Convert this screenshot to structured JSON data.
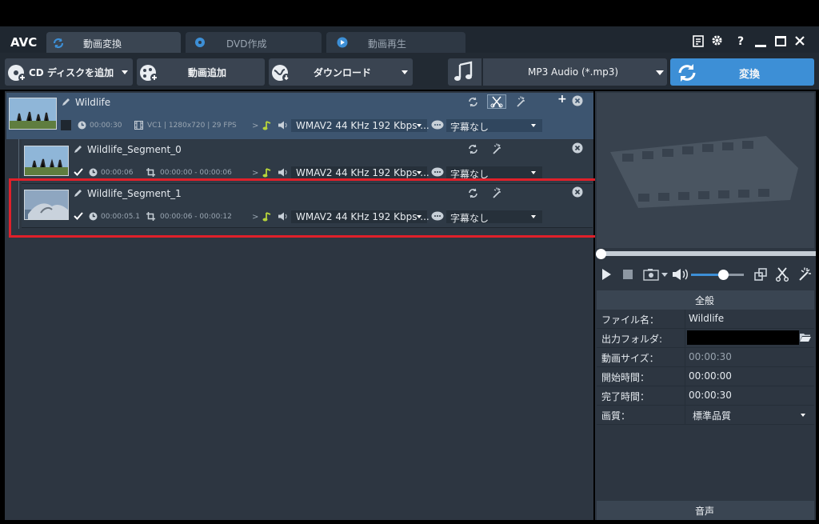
{
  "app": {
    "logo": "AVC"
  },
  "tabs": [
    {
      "label": "動画変換",
      "active": true
    },
    {
      "label": "DVD作成",
      "active": false
    },
    {
      "label": "動画再生",
      "active": false
    }
  ],
  "toolbar": {
    "add_disc": "CD ディスクを追加",
    "add_video": "動画追加",
    "download": "ダウンロード",
    "format": "MP3 Audio (*.mp3)",
    "convert": "変換"
  },
  "files": [
    {
      "name": "Wildlife",
      "duration": "00:00:30",
      "video_info": "VC1 | 1280x720 | 29 FPS",
      "audio": "WMAV2 44 KHz 192 Kbps ...",
      "subtitle": "字幕なし"
    },
    {
      "name": "Wildlife_Segment_0",
      "duration": "00:00:06",
      "range": "00:00:00 - 00:00:06",
      "audio": "WMAV2 44 KHz 192 Kbps ...",
      "subtitle": "字幕なし"
    },
    {
      "name": "Wildlife_Segment_1",
      "duration": "00:00:05.1",
      "range": "00:00:06 - 00:00:12",
      "audio": "WMAV2 44 KHz 192 Kbps ...",
      "subtitle": "字幕なし"
    }
  ],
  "properties": {
    "section_general": "全般",
    "rows": [
      {
        "label": "ファイル名：",
        "value": "Wildlife"
      },
      {
        "label": "出力フォルダ:",
        "value": ""
      },
      {
        "label": "動画サイズ：",
        "value": "00:00:30"
      },
      {
        "label": "開始時間：",
        "value": "00:00:00"
      },
      {
        "label": "完了時間：",
        "value": "00:00:30"
      },
      {
        "label": "画質：",
        "value": "標準品質"
      }
    ],
    "section_audio": "音声"
  },
  "player": {
    "progress": 0.0,
    "volume": 0.6
  },
  "colors": {
    "accent": "#3d8fd6",
    "highlight": "#e0202a",
    "selected_row": "#3d5570"
  }
}
